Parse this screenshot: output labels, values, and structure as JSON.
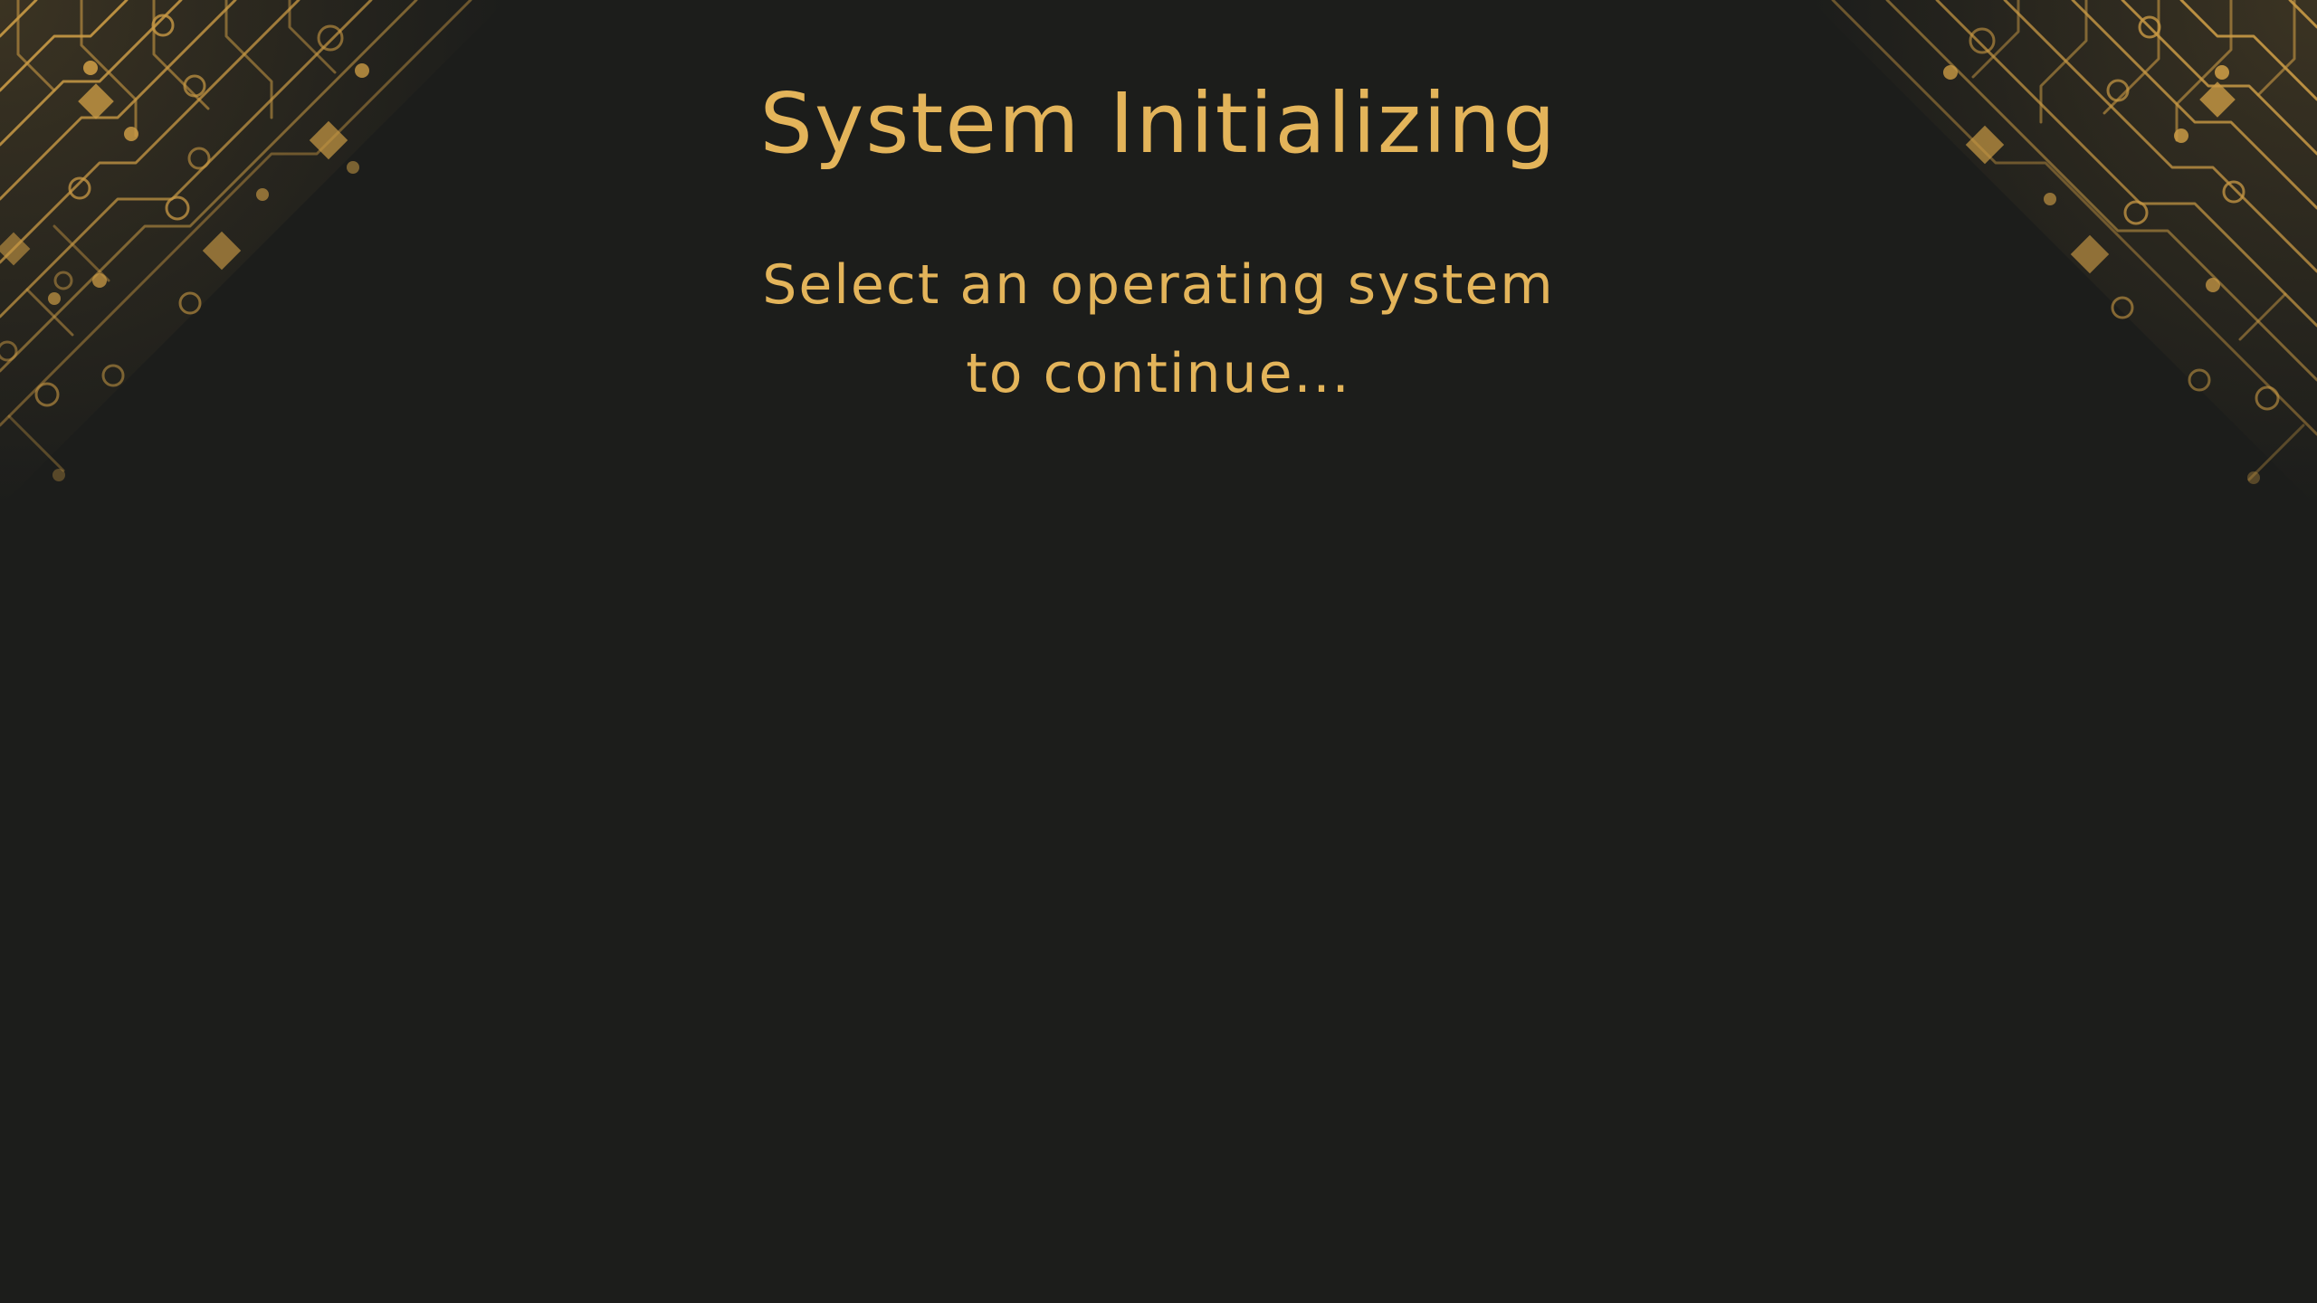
{
  "screen": {
    "title": "System Initializing",
    "message_line_1": "Select an operating system",
    "message_line_2": "to continue...",
    "background_color": "#1c1d1b",
    "accent_color": "#e3b45a"
  },
  "decorations": {
    "left_corner_icon": "circuit-board-pattern-icon",
    "right_corner_icon": "circuit-board-pattern-icon"
  }
}
